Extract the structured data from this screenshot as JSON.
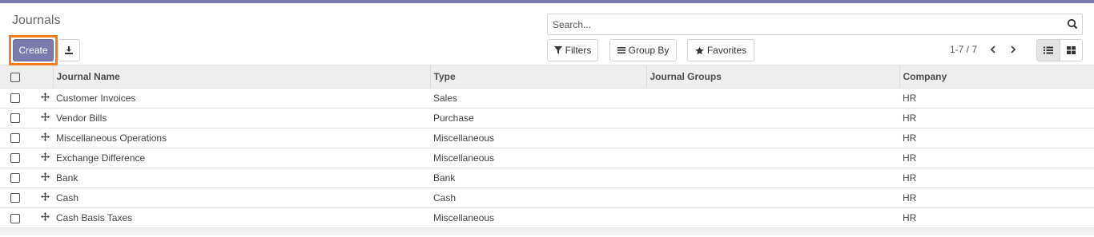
{
  "page": {
    "title": "Journals"
  },
  "toolbar": {
    "create_label": "Create",
    "download_icon": "download-icon"
  },
  "search": {
    "placeholder": "Search...",
    "icon": "search-icon"
  },
  "filters": {
    "filters_label": "Filters",
    "groupby_label": "Group By",
    "favorites_label": "Favorites"
  },
  "pager": {
    "value": "1-7 / 7"
  },
  "colors": {
    "accent": "#7c7bad",
    "highlight": "#f07f22"
  },
  "table": {
    "headers": [
      "Journal Name",
      "Type",
      "Journal Groups",
      "Company"
    ],
    "rows": [
      {
        "name": "Customer Invoices",
        "type": "Sales",
        "groups": "",
        "company": "HR"
      },
      {
        "name": "Vendor Bills",
        "type": "Purchase",
        "groups": "",
        "company": "HR"
      },
      {
        "name": "Miscellaneous Operations",
        "type": "Miscellaneous",
        "groups": "",
        "company": "HR"
      },
      {
        "name": "Exchange Difference",
        "type": "Miscellaneous",
        "groups": "",
        "company": "HR"
      },
      {
        "name": "Bank",
        "type": "Bank",
        "groups": "",
        "company": "HR"
      },
      {
        "name": "Cash",
        "type": "Cash",
        "groups": "",
        "company": "HR"
      },
      {
        "name": "Cash Basis Taxes",
        "type": "Miscellaneous",
        "groups": "",
        "company": "HR"
      }
    ]
  }
}
